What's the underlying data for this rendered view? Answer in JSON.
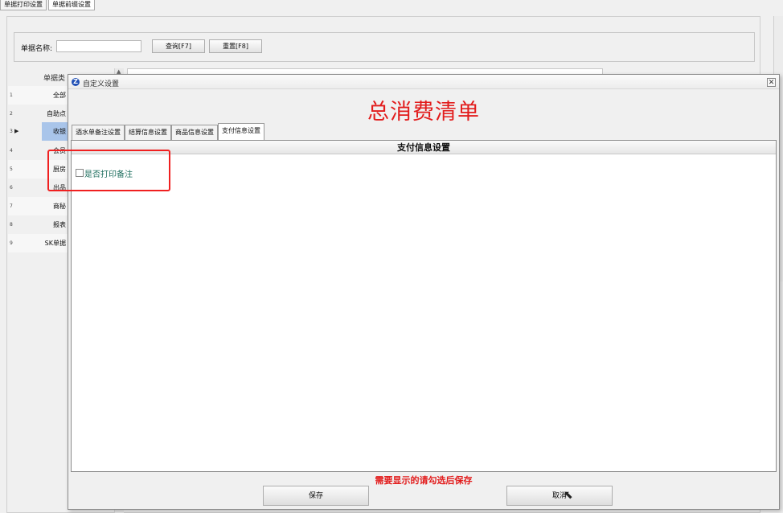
{
  "top_tabs": [
    "单据打印设置",
    "单据前缀设置"
  ],
  "filter": {
    "label": "单据名称:",
    "value": "",
    "query_button": "查询[F7]",
    "reset_button": "重置[F8]"
  },
  "left_grid": {
    "header": "单据类",
    "rows": [
      {
        "idx": "1",
        "name": "全部"
      },
      {
        "idx": "2",
        "name": "自助点"
      },
      {
        "idx": "3",
        "name": "收银"
      },
      {
        "idx": "4",
        "name": "会员"
      },
      {
        "idx": "5",
        "name": "厨房"
      },
      {
        "idx": "6",
        "name": "出品"
      },
      {
        "idx": "7",
        "name": "商秘"
      },
      {
        "idx": "8",
        "name": "报表"
      },
      {
        "idx": "9",
        "name": "SK单据"
      }
    ],
    "selected_row": "3"
  },
  "dialog": {
    "title": "自定义设置",
    "logo_letter": "Z",
    "close_glyph": "✕",
    "big_title": "总消费清单",
    "tabs": [
      "酒水单备注设置",
      "结算信息设置",
      "商品信息设置",
      "支付信息设置"
    ],
    "active_tab": "支付信息设置",
    "section_header": "支付信息设置",
    "checkbox": {
      "label": "是否打印备注",
      "checked": false
    },
    "hint": "需要显示的请勾选后保存",
    "save_button": "保存",
    "cancel_button": "取消"
  },
  "colors": {
    "accent_red": "#e21c1c",
    "selected_row": "#a9c5ea",
    "checkbox_label": "#1f6f5f"
  }
}
